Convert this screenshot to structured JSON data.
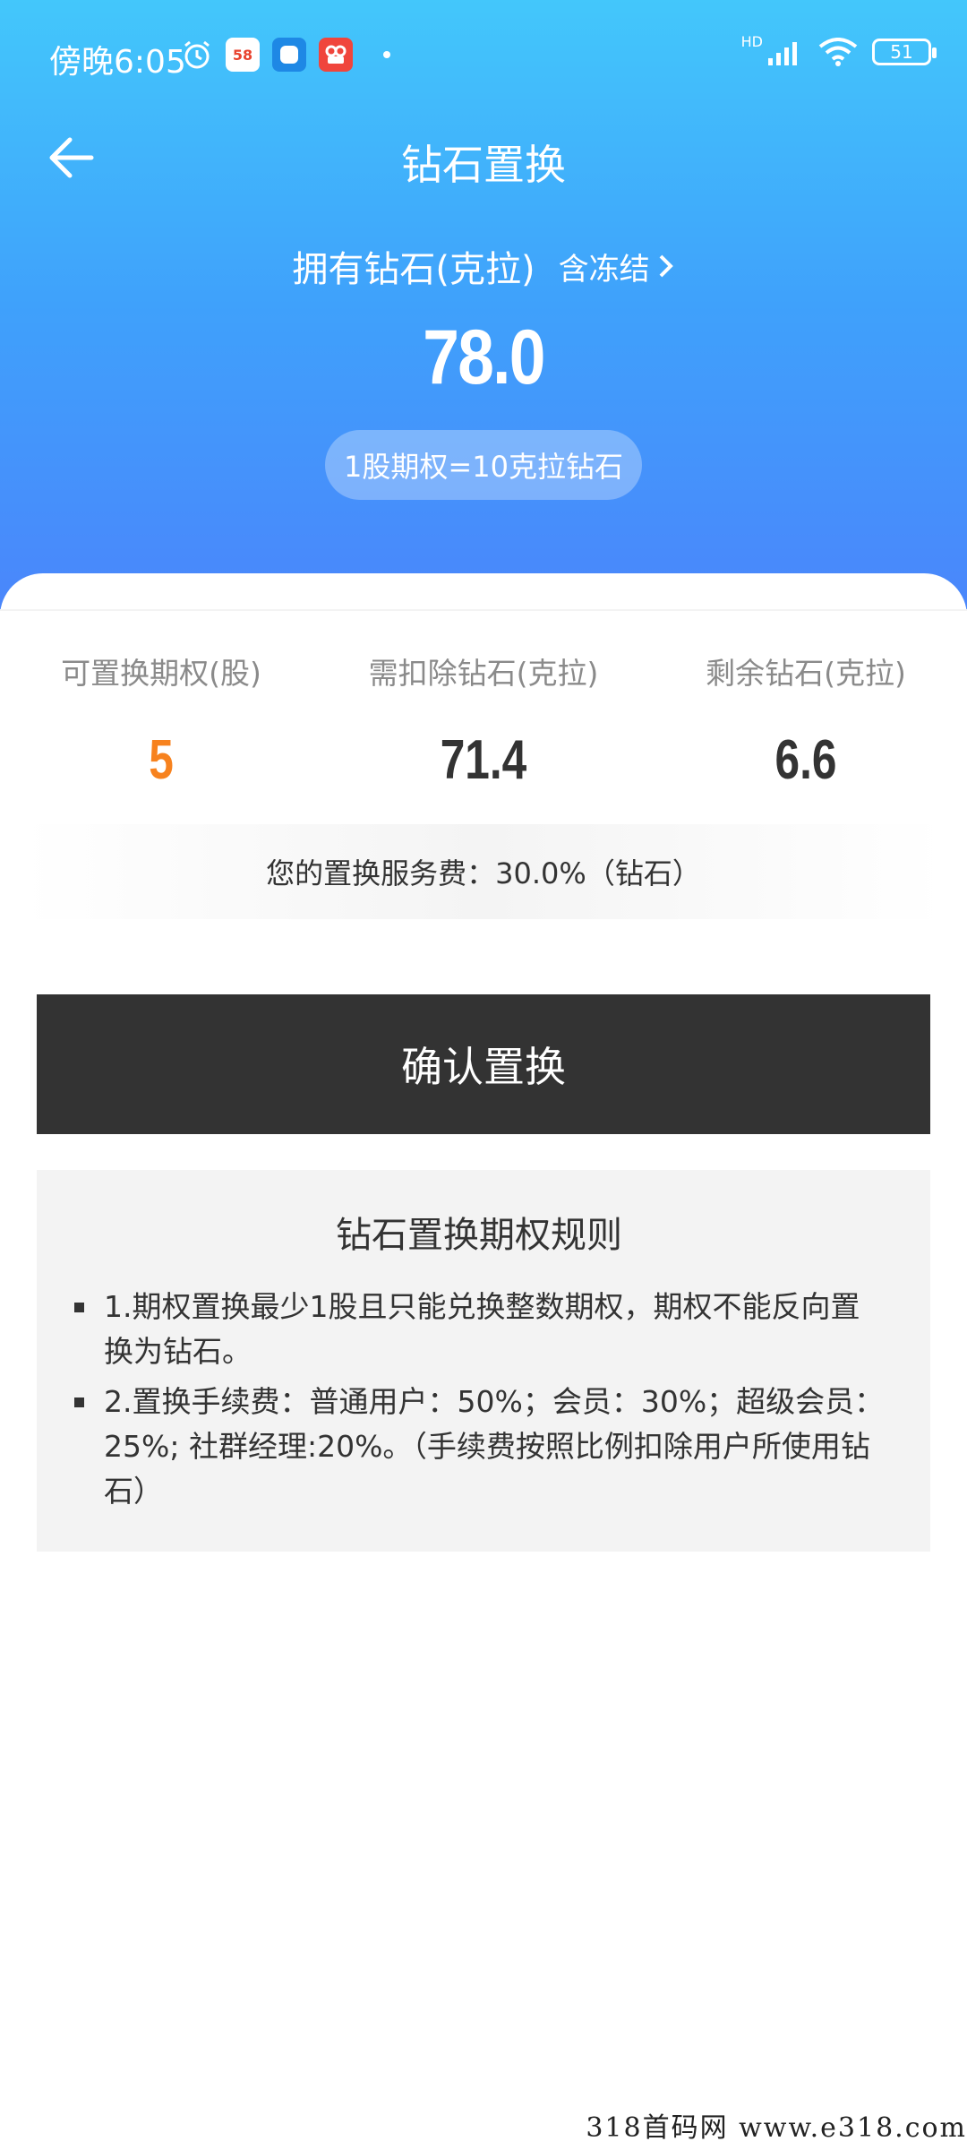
{
  "status_bar": {
    "time": "傍晚6:05",
    "app_58": "58",
    "network": "HD",
    "battery": "51"
  },
  "nav": {
    "title": "钻石置换"
  },
  "header": {
    "own_label": "拥有钻石(克拉)",
    "frozen_label": "含冻结",
    "amount": "78.0",
    "rate": "1股期权=10克拉钻石"
  },
  "stats": [
    {
      "label": "可置换期权(股)",
      "value": "5",
      "color": "#f7821e"
    },
    {
      "label": "需扣除钻石(克拉)",
      "value": "71.4",
      "color": "#333333"
    },
    {
      "label": "剩余钻石(克拉)",
      "value": "6.6",
      "color": "#333333"
    }
  ],
  "fee_text": "您的置换服务费：30.0%（钻石）",
  "confirm_label": "确认置换",
  "rules": {
    "title": "钻石置换期权规则",
    "items": [
      "1.期权置换最少1股且只能兑换整数期权，期权不能反向置换为钻石。",
      "2.置换手续费：普通用户：50%；会员：30%；超级会员：25%; 社群经理:20%。（手续费按照比例扣除用户所使用钻石）"
    ]
  },
  "watermark": "318首码网  www.e318.com",
  "colors": {
    "header_top": "#43c7fb",
    "header_bottom": "#4a86fb",
    "accent_orange": "#f7821e",
    "button": "#333333"
  }
}
